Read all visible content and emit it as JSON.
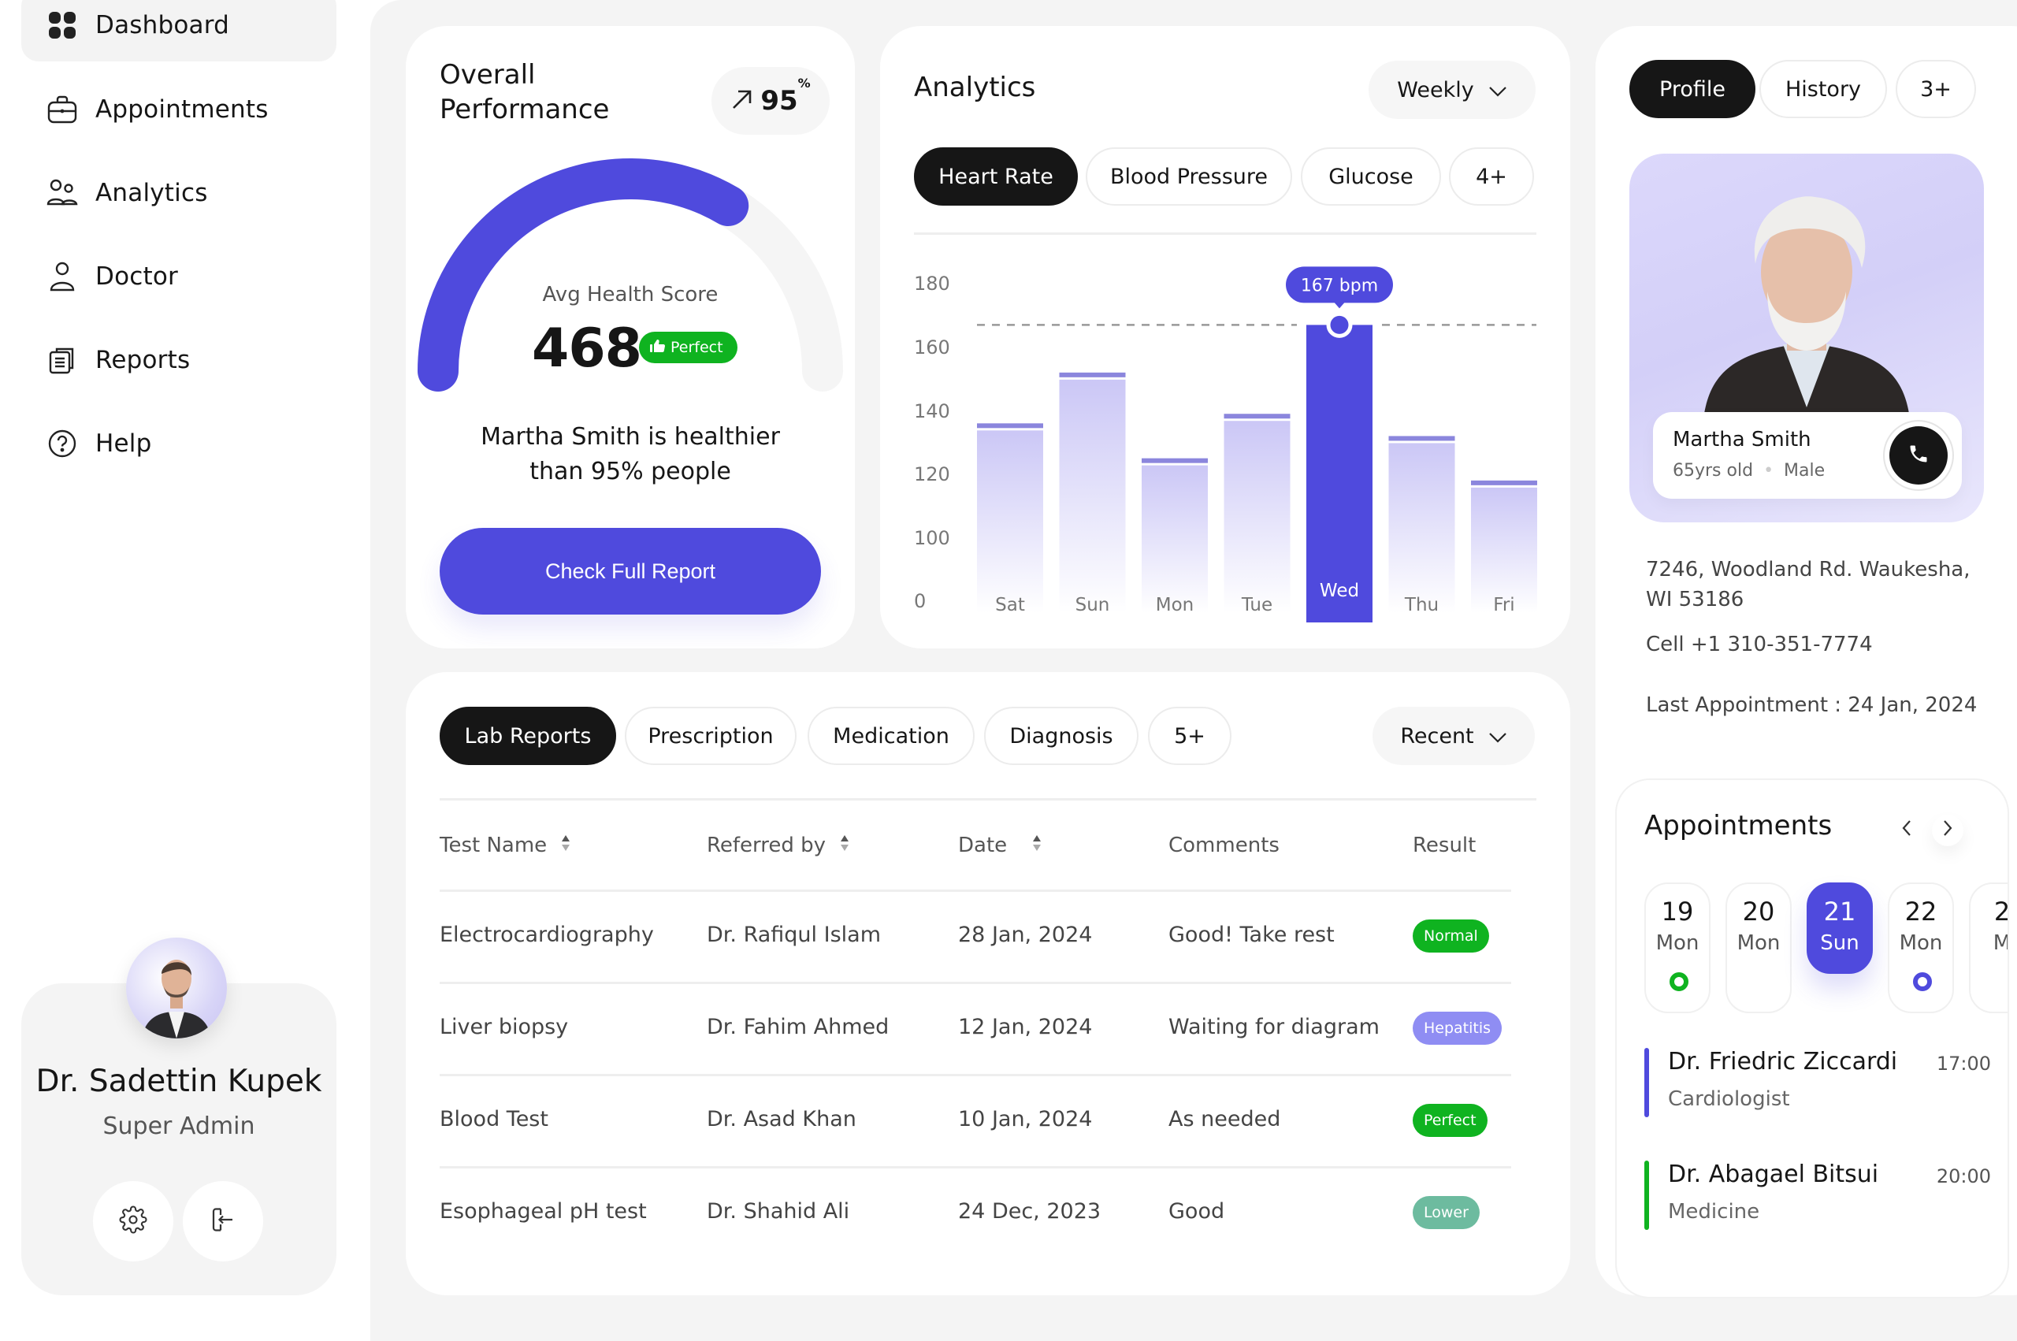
{
  "sidebar": {
    "items": [
      {
        "label": "Dashboard",
        "icon": "dashboard-grid-icon",
        "active": true
      },
      {
        "label": "Appointments",
        "icon": "briefcase-icon",
        "active": false
      },
      {
        "label": "Analytics",
        "icon": "users-icon",
        "active": false
      },
      {
        "label": "Doctor",
        "icon": "user-icon",
        "active": false
      },
      {
        "label": "Reports",
        "icon": "clipboard-icon",
        "active": false
      },
      {
        "label": "Help",
        "icon": "help-circle-icon",
        "active": false
      }
    ],
    "user": {
      "name": "Dr. Sadettin Kupek",
      "role": "Super Admin",
      "settings_icon": "gear-icon",
      "logout_icon": "logout-icon"
    }
  },
  "performance": {
    "title_line1": "Overall",
    "title_line2": "Performance",
    "trend_value": "95",
    "trend_unit": "%",
    "trend_icon": "arrow-up-right-icon",
    "gauge_label": "Avg Health Score",
    "score": "468",
    "score_badge": "Perfect",
    "gauge_fill_fraction": 0.67,
    "description_line1": "Martha Smith is healthier",
    "description_line2": "than 95% people",
    "cta": "Check Full Report"
  },
  "analytics": {
    "title": "Analytics",
    "period": "Weekly",
    "tabs": [
      {
        "label": "Heart Rate",
        "active": true
      },
      {
        "label": "Blood Pressure",
        "active": false
      },
      {
        "label": "Glucose",
        "active": false
      },
      {
        "label": "4+",
        "active": false
      }
    ]
  },
  "chart_data": {
    "type": "bar",
    "title": "Heart Rate",
    "categories": [
      "Sat",
      "Sun",
      "Mon",
      "Tue",
      "Wed",
      "Thu",
      "Fri"
    ],
    "values": [
      136,
      152,
      125,
      139,
      167,
      132,
      118
    ],
    "unit": "bpm",
    "highlight_index": 4,
    "highlight_label": "167 bpm",
    "reference_line": 167,
    "yticks": [
      0,
      100,
      120,
      140,
      160,
      180
    ],
    "ylim": [
      90,
      180
    ],
    "xlabel": "",
    "ylabel": "",
    "grid": false
  },
  "lab": {
    "tabs": [
      {
        "label": "Lab Reports",
        "active": true
      },
      {
        "label": "Prescription",
        "active": false
      },
      {
        "label": "Medication",
        "active": false
      },
      {
        "label": "Diagnosis",
        "active": false
      },
      {
        "label": "5+",
        "active": false
      }
    ],
    "sort": "Recent",
    "columns": [
      "Test Name",
      "Referred by",
      "Date",
      "Comments",
      "Result"
    ],
    "rows": [
      {
        "test": "Electrocardiography",
        "referred": "Dr. Rafiqul Islam",
        "date": "28 Jan, 2024",
        "comment": "Good! Take rest",
        "result": "Normal",
        "color": "#0fb320"
      },
      {
        "test": "Liver biopsy",
        "referred": "Dr. Fahim Ahmed",
        "date": "12 Jan, 2024",
        "comment": "Waiting for diagram",
        "result": "Hepatitis",
        "color": "#8f8df3"
      },
      {
        "test": "Blood Test",
        "referred": "Dr. Asad Khan",
        "date": "10 Jan, 2024",
        "comment": "As needed",
        "result": "Perfect",
        "color": "#0fb320"
      },
      {
        "test": "Esophageal pH test",
        "referred": "Dr. Shahid Ali",
        "date": "24 Dec, 2023",
        "comment": "Good",
        "result": "Lower",
        "color": "#6dbb9f"
      }
    ]
  },
  "profile": {
    "tabs": [
      {
        "label": "Profile",
        "active": true
      },
      {
        "label": "History",
        "active": false
      },
      {
        "label": "3+",
        "active": false
      }
    ],
    "name": "Martha Smith",
    "age": "65yrs old",
    "gender": "Male",
    "address_line1": "7246, Woodland Rd. Waukesha,",
    "address_line2": "WI 53186",
    "cell": "Cell +1 310-351-7774",
    "last_appointment": "Last Appointment : 24 Jan, 2024"
  },
  "appointments": {
    "title": "Appointments",
    "days": [
      {
        "num": "19",
        "name": "Mon",
        "dot": "#0fb320",
        "active": false
      },
      {
        "num": "20",
        "name": "Mon",
        "dot": null,
        "active": false
      },
      {
        "num": "21",
        "name": "Sun",
        "dot": null,
        "active": true
      },
      {
        "num": "22",
        "name": "Mon",
        "dot": "#4f4add",
        "active": false
      },
      {
        "num": "2",
        "name": "M",
        "dot": null,
        "active": false
      }
    ],
    "items": [
      {
        "doctor": "Dr. Friedric Ziccardi",
        "specialty": "Cardiologist",
        "time": "17:00",
        "color": "#4f4add"
      },
      {
        "doctor": "Dr. Abagael Bitsui",
        "specialty": "Medicine",
        "time": "20:00",
        "color": "#0fb320"
      }
    ]
  },
  "colors": {
    "accent": "#4f4add",
    "success": "#0fb320",
    "dark": "#161616",
    "panel": "#f4f4f4"
  }
}
